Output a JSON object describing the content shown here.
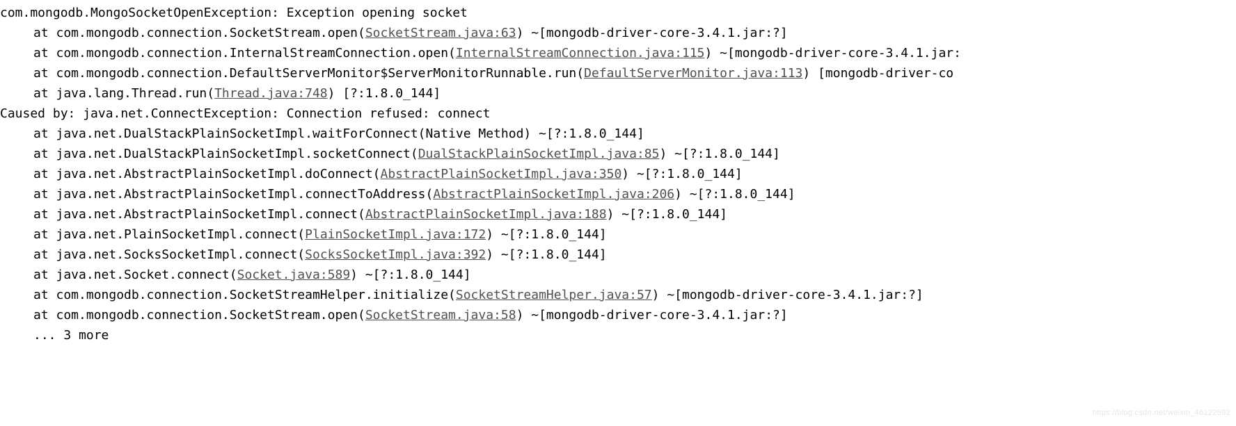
{
  "stacktrace": {
    "exception_line": "com.mongodb.MongoSocketOpenException: Exception opening socket",
    "frames": [
      {
        "pre": "at com.mongodb.connection.SocketStream.open(",
        "link": "SocketStream.java:63",
        "post": ") ~[mongodb-driver-core-3.4.1.jar:?]"
      },
      {
        "pre": "at com.mongodb.connection.InternalStreamConnection.open(",
        "link": "InternalStreamConnection.java:115",
        "post": ") ~[mongodb-driver-core-3.4.1.jar:"
      },
      {
        "pre": "at com.mongodb.connection.DefaultServerMonitor$ServerMonitorRunnable.run(",
        "link": "DefaultServerMonitor.java:113",
        "post": ") [mongodb-driver-co"
      },
      {
        "pre": "at java.lang.Thread.run(",
        "link": "Thread.java:748",
        "post": ") [?:1.8.0_144]"
      }
    ],
    "caused_by_line": "Caused by: java.net.ConnectException: Connection refused: connect",
    "caused_frames": [
      {
        "pre": "at java.net.DualStackPlainSocketImpl.waitForConnect(Native Method) ~[?:1.8.0_144]",
        "link": "",
        "post": ""
      },
      {
        "pre": "at java.net.DualStackPlainSocketImpl.socketConnect(",
        "link": "DualStackPlainSocketImpl.java:85",
        "post": ") ~[?:1.8.0_144]"
      },
      {
        "pre": "at java.net.AbstractPlainSocketImpl.doConnect(",
        "link": "AbstractPlainSocketImpl.java:350",
        "post": ") ~[?:1.8.0_144]"
      },
      {
        "pre": "at java.net.AbstractPlainSocketImpl.connectToAddress(",
        "link": "AbstractPlainSocketImpl.java:206",
        "post": ") ~[?:1.8.0_144]"
      },
      {
        "pre": "at java.net.AbstractPlainSocketImpl.connect(",
        "link": "AbstractPlainSocketImpl.java:188",
        "post": ") ~[?:1.8.0_144]"
      },
      {
        "pre": "at java.net.PlainSocketImpl.connect(",
        "link": "PlainSocketImpl.java:172",
        "post": ") ~[?:1.8.0_144]"
      },
      {
        "pre": "at java.net.SocksSocketImpl.connect(",
        "link": "SocksSocketImpl.java:392",
        "post": ") ~[?:1.8.0_144]"
      },
      {
        "pre": "at java.net.Socket.connect(",
        "link": "Socket.java:589",
        "post": ") ~[?:1.8.0_144]"
      },
      {
        "pre": "at com.mongodb.connection.SocketStreamHelper.initialize(",
        "link": "SocketStreamHelper.java:57",
        "post": ") ~[mongodb-driver-core-3.4.1.jar:?]"
      },
      {
        "pre": "at com.mongodb.connection.SocketStream.open(",
        "link": "SocketStream.java:58",
        "post": ") ~[mongodb-driver-core-3.4.1.jar:?]"
      }
    ],
    "omitted_line": "... 3 more"
  },
  "watermark": "https://blog.csdn.net/weixin_46122592"
}
